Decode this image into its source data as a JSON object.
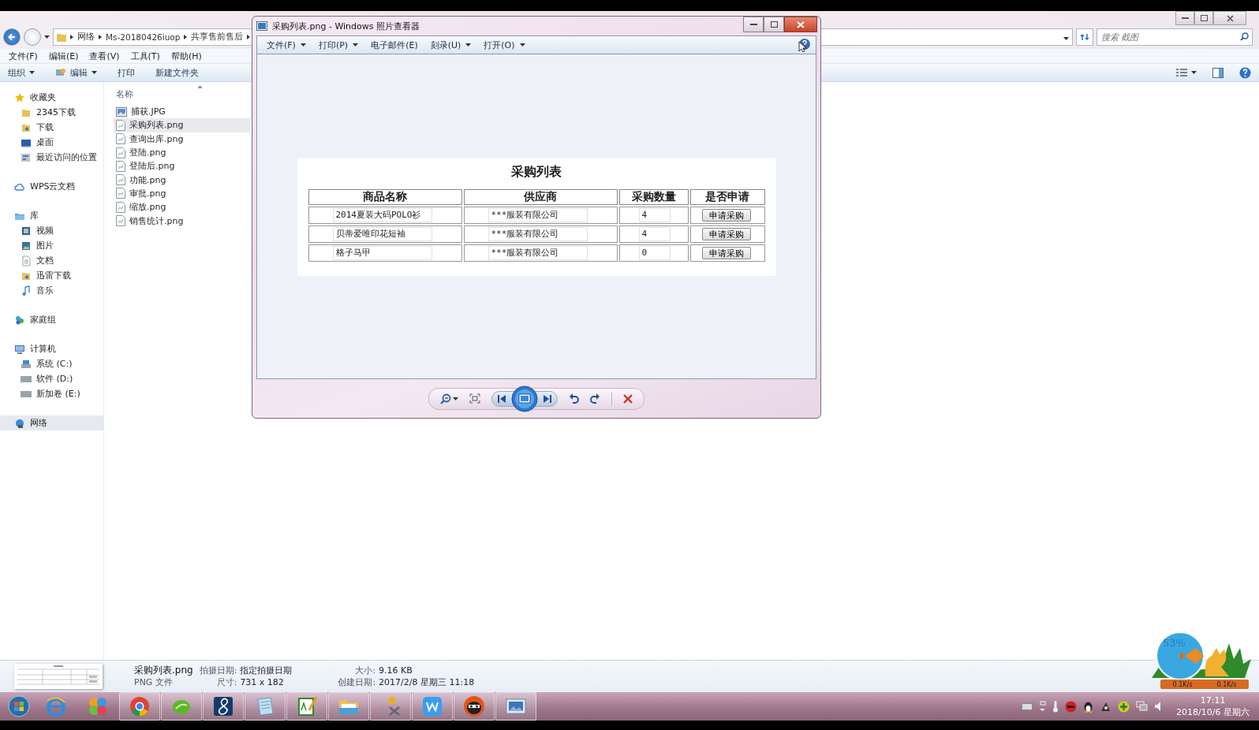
{
  "explorer": {
    "breadcrumbs": [
      "网络",
      "Ms-20180426iuop",
      "共享售前售后"
    ],
    "search": {
      "placeholder": "搜索 截图"
    },
    "menu": [
      "文件(F)",
      "编辑(E)",
      "查看(V)",
      "工具(T)",
      "帮助(H)"
    ],
    "toolbar": [
      {
        "label": "组织",
        "dropdown": true,
        "kind": "text"
      },
      {
        "label": "编辑",
        "dropdown": true,
        "kind": "icon"
      },
      {
        "label": "打印",
        "dropdown": false,
        "kind": "text"
      },
      {
        "label": "新建文件夹",
        "dropdown": false,
        "kind": "text"
      }
    ],
    "nav": [
      {
        "label": "收藏夹",
        "kind": "favorites",
        "selected": false,
        "children": [
          {
            "label": "2345下载",
            "kind": "folder",
            "selected": false
          },
          {
            "label": "下载",
            "kind": "downloads",
            "selected": false
          },
          {
            "label": "桌面",
            "kind": "desktop",
            "selected": false
          },
          {
            "label": "最近访问的位置",
            "kind": "recent",
            "selected": false
          }
        ]
      },
      {
        "label": "WPS云文档",
        "kind": "cloud",
        "selected": false
      },
      {
        "label": "库",
        "kind": "library",
        "selected": false,
        "children": [
          {
            "label": "视频",
            "kind": "video",
            "selected": false
          },
          {
            "label": "图片",
            "kind": "pictures",
            "selected": false
          },
          {
            "label": "文档",
            "kind": "documents",
            "selected": false
          },
          {
            "label": "迅雷下载",
            "kind": "downloads",
            "selected": false
          },
          {
            "label": "音乐",
            "kind": "music",
            "selected": false
          }
        ]
      },
      {
        "label": "家庭组",
        "kind": "homegroup",
        "selected": false
      },
      {
        "label": "计算机",
        "kind": "computer",
        "selected": false,
        "children": [
          {
            "label": "系统 (C:)",
            "kind": "system-drive",
            "selected": false
          },
          {
            "label": "软件 (D:)",
            "kind": "drive",
            "selected": false
          },
          {
            "label": "新加卷 (E:)",
            "kind": "drive",
            "selected": false
          }
        ]
      },
      {
        "label": "网络",
        "kind": "network",
        "selected": true
      }
    ],
    "column_header": "名称",
    "files": [
      {
        "name": "捕获.JPG",
        "kind": "jpg",
        "selected": false
      },
      {
        "name": "采购列表.png",
        "kind": "png",
        "selected": true
      },
      {
        "name": "查询出库.png",
        "kind": "png",
        "selected": false
      },
      {
        "name": "登陆.png",
        "kind": "png",
        "selected": false
      },
      {
        "name": "登陆后.png",
        "kind": "png",
        "selected": false
      },
      {
        "name": "功能.png",
        "kind": "png",
        "selected": false
      },
      {
        "name": "审批.png",
        "kind": "png",
        "selected": false
      },
      {
        "name": "缩放.png",
        "kind": "png",
        "selected": false
      },
      {
        "name": "销售统计.png",
        "kind": "png",
        "selected": false
      }
    ],
    "details": {
      "name": "采购列表.png",
      "type": "PNG 文件",
      "fields": [
        {
          "label": "拍摄日期:",
          "value": "指定拍摄日期"
        },
        {
          "label": "尺寸:",
          "value": "731 x 182"
        },
        {
          "label": "大小:",
          "value": "9.16 KB"
        },
        {
          "label": "创建日期:",
          "value": "2017/2/8 星期三 11:18"
        }
      ]
    }
  },
  "viewer": {
    "title": "采购列表.png - Windows 照片查看器",
    "menu": [
      {
        "label": "文件(F)",
        "dropdown": true
      },
      {
        "label": "打印(P)",
        "dropdown": true
      },
      {
        "label": "电子邮件(E)",
        "dropdown": false
      },
      {
        "label": "刻录(U)",
        "dropdown": true
      },
      {
        "label": "打开(O)",
        "dropdown": true
      }
    ],
    "image": {
      "title": "采购列表",
      "columns": [
        "商品名称",
        "供应商",
        "采购数量",
        "是否申请"
      ],
      "rows": [
        {
          "name": "2014夏装大码POLO衫",
          "supplier": "***服装有限公司",
          "quantity": "4",
          "action": "申请采购"
        },
        {
          "name": "贝蒂爱唯印花短袖",
          "supplier": "***服装有限公司",
          "quantity": "4",
          "action": "申请采购"
        },
        {
          "name": "格子马甲",
          "supplier": "***服装有限公司",
          "quantity": "0",
          "action": "申请采购"
        }
      ]
    }
  },
  "widget": {
    "percent": "53%",
    "upload": "0.1K/s",
    "download": "0.1K/s"
  },
  "taskbar": {
    "apps": [
      {
        "kind": "ie",
        "open": false
      },
      {
        "kind": "circles",
        "open": false
      },
      {
        "kind": "chrome",
        "open": true
      },
      {
        "kind": "leaf",
        "open": true
      },
      {
        "kind": "eight",
        "open": true
      },
      {
        "kind": "notepad",
        "open": true
      },
      {
        "kind": "editor",
        "open": true
      },
      {
        "kind": "folder",
        "open": true
      },
      {
        "kind": "tools",
        "open": true
      },
      {
        "kind": "wps",
        "open": true
      },
      {
        "kind": "cat",
        "open": true
      },
      {
        "kind": "viewer",
        "open": true
      }
    ],
    "clock": {
      "time": "17:11",
      "date": "2018/10/6 星期六"
    }
  }
}
